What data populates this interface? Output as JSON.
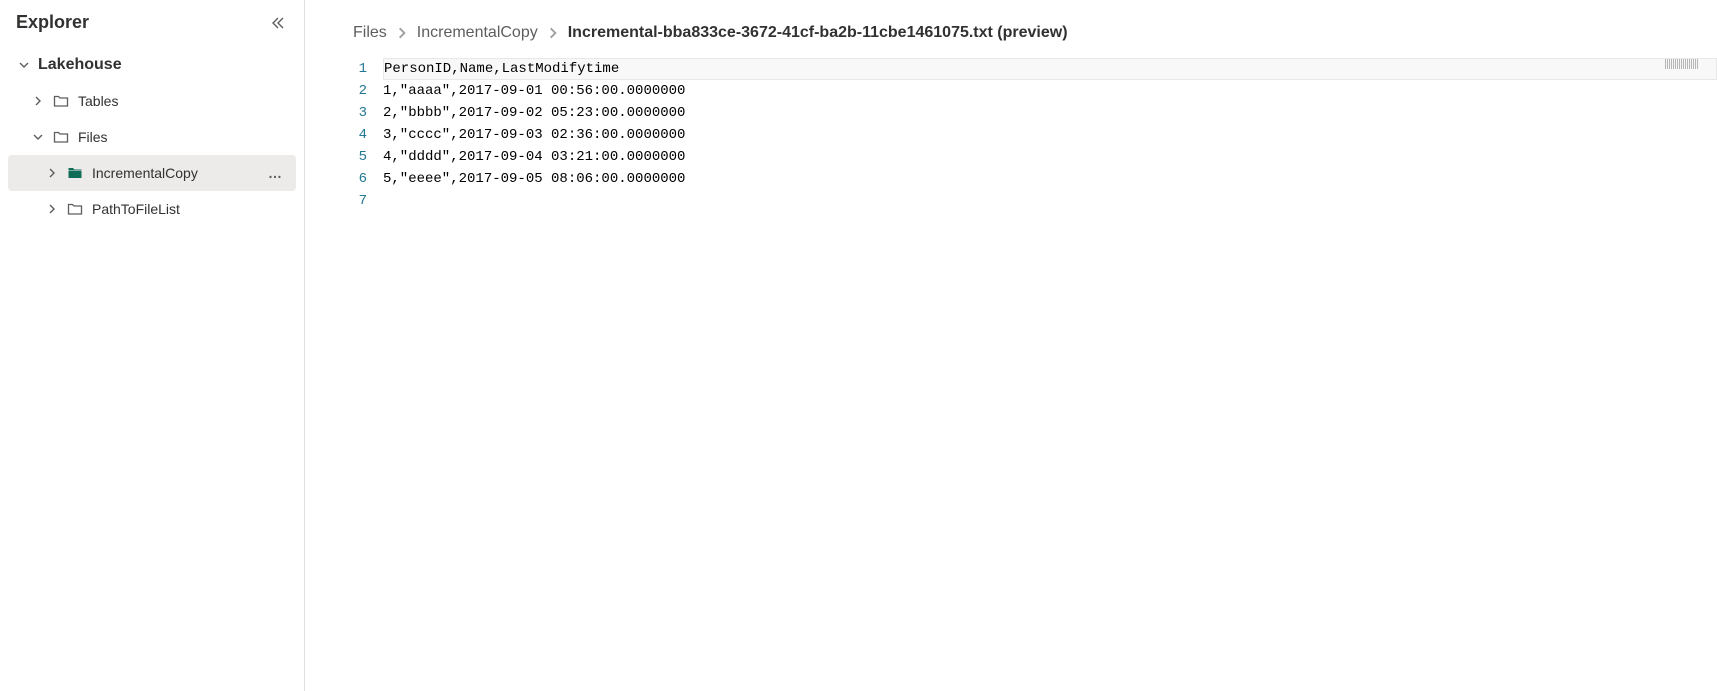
{
  "sidebar": {
    "title": "Explorer",
    "root": {
      "label": "Lakehouse"
    },
    "items": [
      {
        "label": "Tables"
      },
      {
        "label": "Files"
      },
      {
        "label": "IncrementalCopy"
      },
      {
        "label": "PathToFileList"
      }
    ]
  },
  "breadcrumb": {
    "items": [
      {
        "label": "Files"
      },
      {
        "label": "IncrementalCopy"
      },
      {
        "label": "Incremental-bba833ce-3672-41cf-ba2b-11cbe1461075.txt (preview)"
      }
    ]
  },
  "editor": {
    "lines": [
      "PersonID,Name,LastModifytime",
      "1,\"aaaa\",2017-09-01 00:56:00.0000000",
      "2,\"bbbb\",2017-09-02 05:23:00.0000000",
      "3,\"cccc\",2017-09-03 02:36:00.0000000",
      "4,\"dddd\",2017-09-04 03:21:00.0000000",
      "5,\"eeee\",2017-09-05 08:06:00.0000000",
      ""
    ],
    "lineNumbers": [
      "1",
      "2",
      "3",
      "4",
      "5",
      "6",
      "7"
    ]
  }
}
